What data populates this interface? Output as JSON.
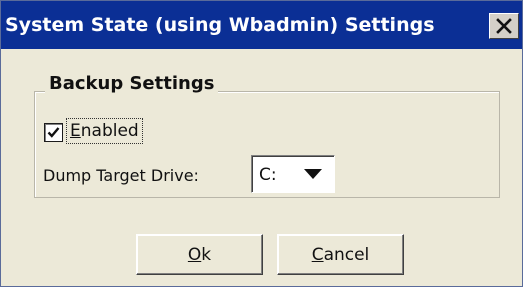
{
  "window": {
    "title": "System State (using Wbadmin) Settings",
    "close_icon": "close-x-icon"
  },
  "backup_settings": {
    "legend": "Backup Settings",
    "enabled": {
      "checked": true,
      "label_mnemonic": "E",
      "label_rest": "nabled"
    },
    "dump_target_drive": {
      "label": "Dump Target Drive:",
      "selected_value": "C:",
      "arrow_icon": "dropdown-arrow-icon"
    }
  },
  "buttons": {
    "ok": {
      "mnemonic": "O",
      "rest": "k"
    },
    "cancel": {
      "mnemonic": "C",
      "rest": "ancel"
    }
  },
  "colors": {
    "titlebar": "#0b2f95",
    "dialog_bg": "#ece9d8"
  }
}
